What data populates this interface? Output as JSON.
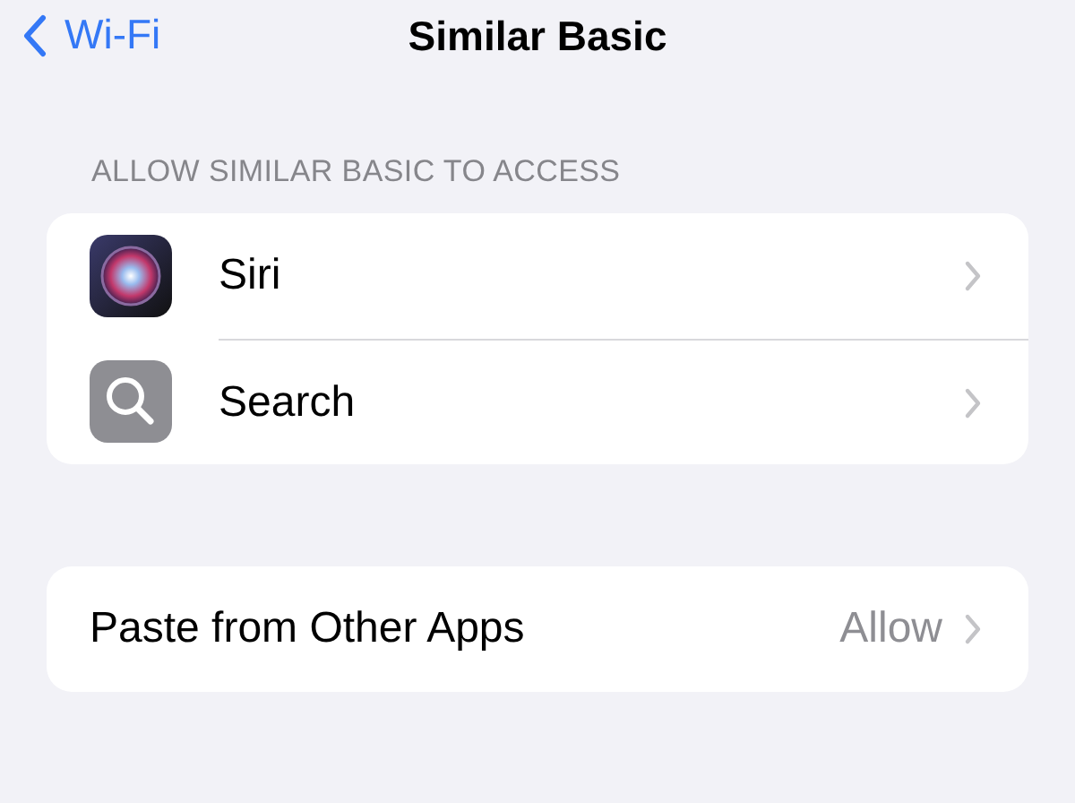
{
  "nav": {
    "back": "Wi-Fi",
    "title": "Similar Basic"
  },
  "sections": [
    {
      "header": "ALLOW SIMILAR BASIC TO ACCESS",
      "rows": [
        {
          "label": "Siri",
          "kind": "orb"
        },
        {
          "label": "Search",
          "kind": "search"
        }
      ]
    },
    {
      "rows": [
        {
          "label": "Paste from Other Apps",
          "value": "Allow"
        }
      ]
    }
  ]
}
